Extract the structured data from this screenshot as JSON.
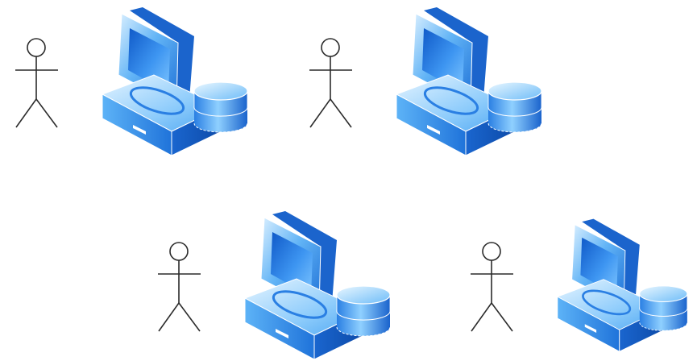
{
  "colors": {
    "outline": "#2b2b2b",
    "device_light": "#cfe9ff",
    "device_mid": "#5ab0f5",
    "device_dark": "#1b6fd8",
    "device_deep": "#0d4fb3",
    "screen": "#2f86ee"
  },
  "nodes": [
    {
      "actor_icon": "stick-figure-icon",
      "device_icon": "computer-with-database-icon"
    },
    {
      "actor_icon": "stick-figure-icon",
      "device_icon": "computer-with-database-icon"
    },
    {
      "actor_icon": "stick-figure-icon",
      "device_icon": "computer-with-database-icon"
    },
    {
      "actor_icon": "stick-figure-icon",
      "device_icon": "computer-with-database-icon"
    }
  ]
}
